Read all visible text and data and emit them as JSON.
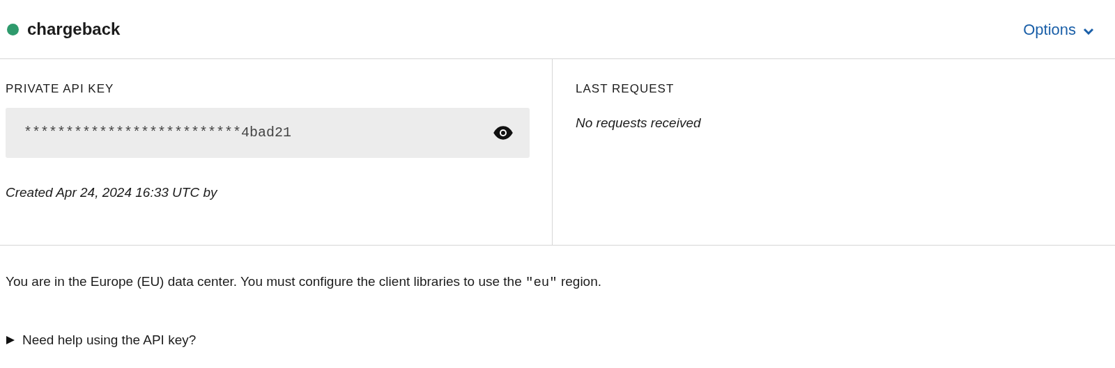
{
  "header": {
    "title": "chargeback",
    "color": "#2e9a6c",
    "options_label": "Options"
  },
  "api_key": {
    "label": "PRIVATE API KEY",
    "value": "**************************4bad21",
    "revealed": false,
    "created": "Created Apr 24, 2024 16:33 UTC by"
  },
  "last_request": {
    "label": "LAST REQUEST",
    "value": "No requests received"
  },
  "notice": {
    "before": "You are in the Europe (EU) data center. You must configure the client libraries to use the ",
    "code": "\"eu\"",
    "after": " region."
  },
  "help": {
    "label": "Need help using the API key?",
    "expanded": false
  }
}
